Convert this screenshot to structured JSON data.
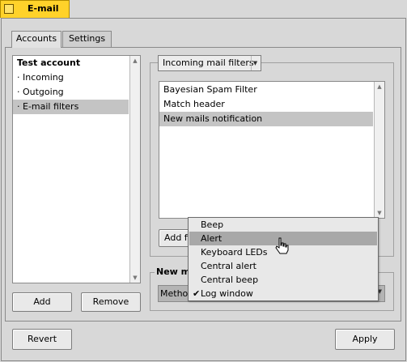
{
  "window": {
    "title": "E-mail"
  },
  "tabs": [
    {
      "label": "Accounts"
    },
    {
      "label": "Settings"
    }
  ],
  "accounts_list": {
    "items": [
      {
        "label": "Test account"
      },
      {
        "label": "· Incoming"
      },
      {
        "label": "· Outgoing"
      },
      {
        "label": "· E-mail filters"
      }
    ]
  },
  "left_buttons": {
    "add": "Add",
    "remove": "Remove"
  },
  "filters_section": {
    "dropdown_value": "Incoming mail filters",
    "filters": [
      {
        "label": "Bayesian Spam Filter"
      },
      {
        "label": "Match header"
      },
      {
        "label": "New mails notification"
      }
    ],
    "add_button_partial": "Add filt"
  },
  "notification_group": {
    "title_partial": "New ma",
    "method_label_partial": "Method"
  },
  "popup_menu": {
    "items": [
      {
        "label": "Beep"
      },
      {
        "label": "Alert"
      },
      {
        "label": "Keyboard LEDs"
      },
      {
        "label": "Central alert"
      },
      {
        "label": "Central beep"
      },
      {
        "label": "Log window"
      }
    ],
    "check_glyph": "✔"
  },
  "bottom_buttons": {
    "revert": "Revert",
    "apply": "Apply"
  },
  "colors": {
    "title_accent": "#ffd22a",
    "selection": "#c4c4c4",
    "menu_highlight": "#a8a8a8"
  }
}
